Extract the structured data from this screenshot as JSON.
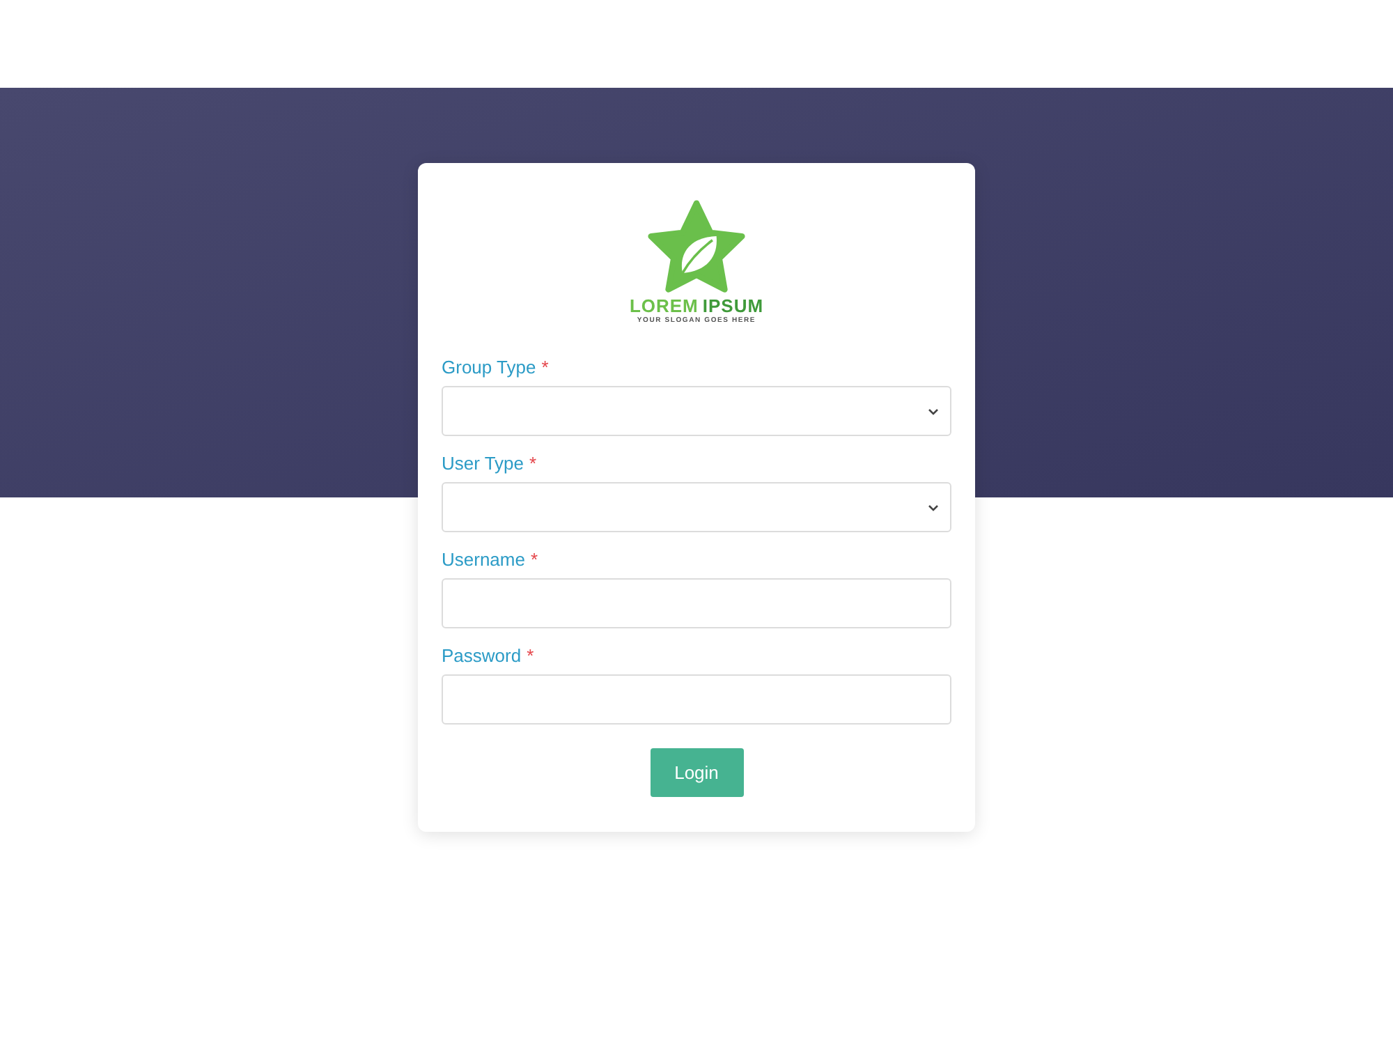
{
  "logo": {
    "name_part_1": "LOREM",
    "name_part_2": "IPSUM",
    "slogan": "YOUR SLOGAN GOES HERE"
  },
  "fields": [
    {
      "kind": "select",
      "label": "Group Type",
      "required_mark": "*"
    },
    {
      "kind": "select",
      "label": "User Type",
      "required_mark": "*"
    },
    {
      "kind": "text",
      "label": "Username",
      "required_mark": "*"
    },
    {
      "kind": "password",
      "label": "Password",
      "required_mark": "*"
    }
  ],
  "login_button": "Login"
}
